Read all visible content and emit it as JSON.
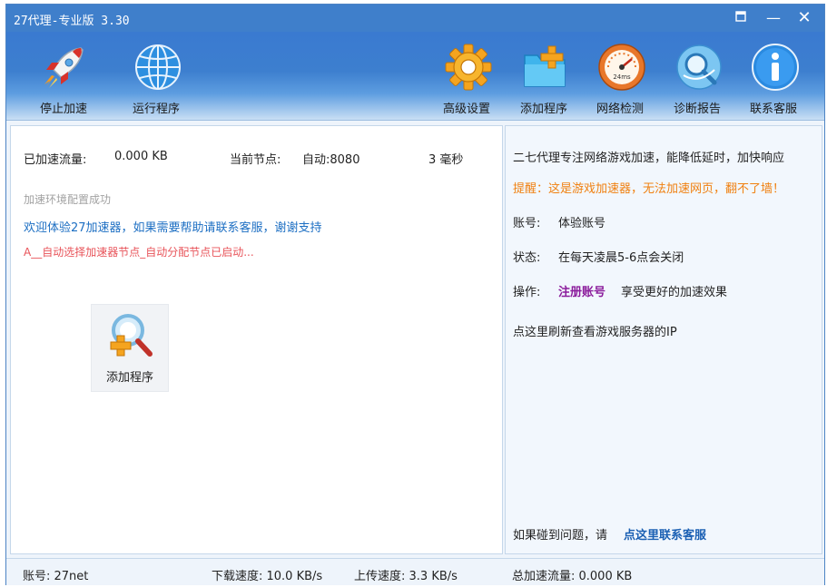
{
  "window": {
    "title": "27代理-专业版 3.30",
    "pin_icon": "pin-icon",
    "minimize_symbol": "—",
    "close_symbol": "✕"
  },
  "toolbar": {
    "stop_accel": {
      "label": "停止加速",
      "icon": "rocket-icon"
    },
    "run_program": {
      "label": "运行程序",
      "icon": "globe-icon"
    },
    "advanced_settings": {
      "label": "高级设置",
      "icon": "gear-icon"
    },
    "add_program": {
      "label": "添加程序",
      "icon": "folder-add-icon"
    },
    "network_check": {
      "label": "网络检测",
      "icon": "speedometer-icon",
      "gauge_text": "24ms"
    },
    "diagnose_report": {
      "label": "诊断报告",
      "icon": "diagnostic-icon"
    },
    "contact_support": {
      "label": "联系客服",
      "icon": "info-icon"
    }
  },
  "stats": {
    "traffic_label": "已加速流量:",
    "traffic_value": "0.000 KB",
    "node_label": "当前节点:",
    "node_value": "自动:8080",
    "latency": "3 毫秒"
  },
  "log": {
    "line1": "加速环境配置成功",
    "line2": "欢迎体验27加速器，如果需要帮助请联系客服，谢谢支持",
    "line3": "A__自动选择加速器节点_自动分配节点已启动..."
  },
  "add_tile": {
    "label": "添加程序",
    "icon": "magnifier-add-icon"
  },
  "info": {
    "slogan": "二七代理专注网络游戏加速，能降低延时，加快响应",
    "notice": "提醒：这是游戏加速器，无法加速网页，翻不了墙！",
    "account_label": "账号:",
    "account_value": "体验账号",
    "status_label": "状态:",
    "status_value": "在每天凌晨5-6点会关闭",
    "action_label": "操作:",
    "register_link": "注册账号",
    "register_desc": "享受更好的加速效果",
    "refresh_ip": "点这里刷新查看游戏服务器的IP",
    "help_prefix": "如果碰到问题，请",
    "help_link": "点这里联系客服"
  },
  "statusbar": {
    "account": "账号: 27net",
    "download": "下载速度: 10.0 KB/s",
    "upload": "上传速度: 3.3 KB/s",
    "total": "总加速流量: 0.000 KB"
  },
  "colors": {
    "title_bar": "#3f7fcb",
    "accent_blue": "#1d6fc3",
    "notice_orange": "#f08010",
    "log_red": "#e8545a",
    "register_purple": "#8b1c9c"
  }
}
